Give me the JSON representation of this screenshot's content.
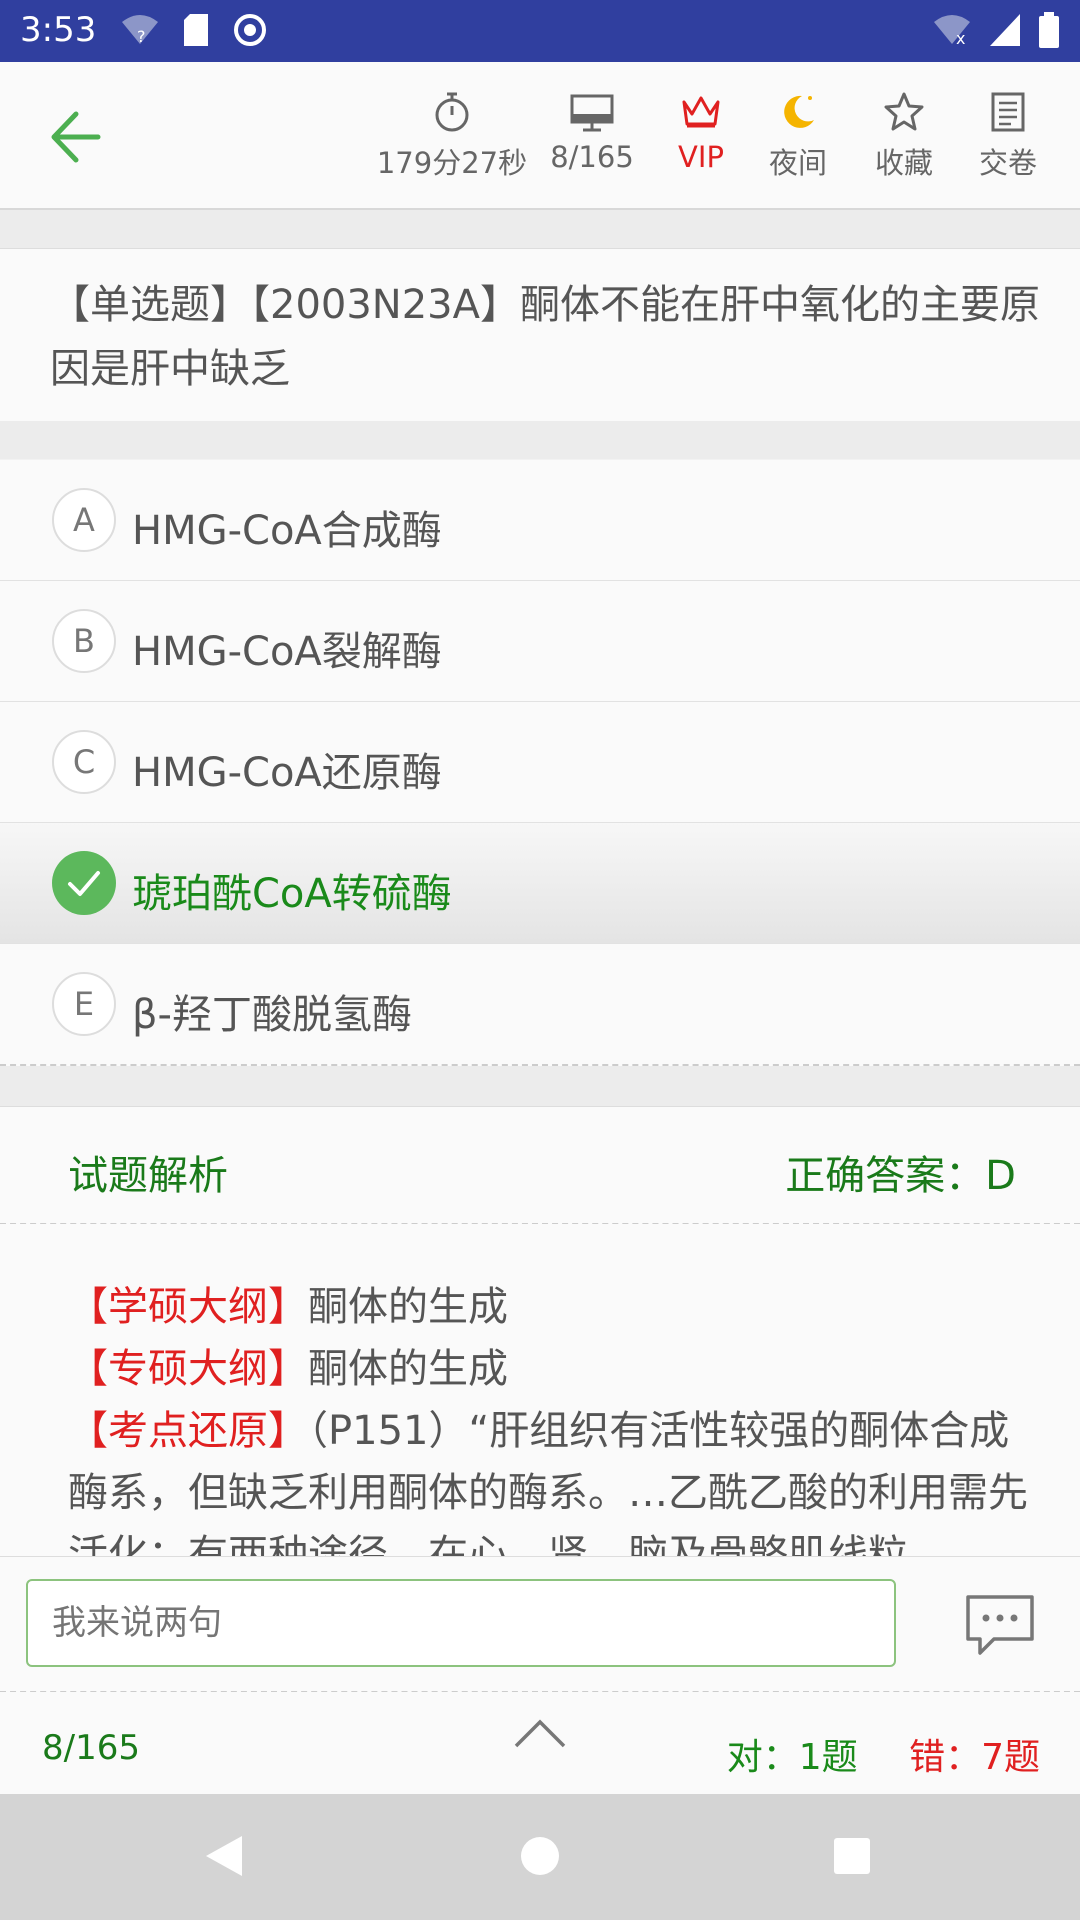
{
  "status_bar": {
    "time": "3:53"
  },
  "toolbar": {
    "timer": "179分27秒",
    "progress": "8/165",
    "vip": "VIP",
    "night": "夜间",
    "favorite": "收藏",
    "submit": "交卷"
  },
  "question": {
    "text": "【单选题】【2003N23A】酮体不能在肝中氧化的主要原因是肝中缺乏"
  },
  "options": [
    {
      "letter": "A",
      "text": "HMG-CoA合成酶"
    },
    {
      "letter": "B",
      "text": "HMG-CoA裂解酶"
    },
    {
      "letter": "C",
      "text": "HMG-CoA还原酶"
    },
    {
      "letter": "D",
      "text": "琥珀酰CoA转硫酶",
      "selected": true
    },
    {
      "letter": "E",
      "text": "β-羟丁酸脱氢酶"
    }
  ],
  "analysis": {
    "title": "试题解析",
    "answer": "正确答案：D",
    "lines": [
      {
        "tag": "【学硕大纲】",
        "text": "酮体的生成"
      },
      {
        "tag": "【专硕大纲】",
        "text": "酮体的生成"
      },
      {
        "tag": "【考点还原】",
        "text": "（P151）“肝组织有活性较强的酮体合成酶系，但缺乏利用酮体的酶系。…乙酰乙酸的利用需先活化：有两种途径，在心、肾、脑及骨骼肌线粒"
      }
    ]
  },
  "comment": {
    "placeholder": "我来说两句"
  },
  "footer": {
    "progress": "8/165",
    "correct": "对：1题",
    "wrong": "错：7题"
  },
  "colors": {
    "accent_green": "#1a7a1a",
    "red": "#e02020",
    "status_bar": "#303f9f"
  },
  "icons": [
    "back-arrow-icon",
    "stopwatch-icon",
    "monitor-icon",
    "crown-icon",
    "moon-icon",
    "star-icon",
    "document-icon",
    "check-icon",
    "comment-icon",
    "chevron-up-icon"
  ]
}
